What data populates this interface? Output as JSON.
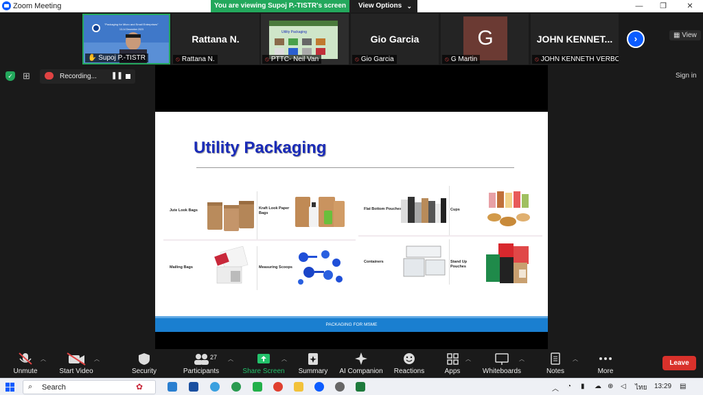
{
  "window": {
    "title": "Zoom Meeting",
    "minimize": "—",
    "restore": "❐",
    "close": "✕"
  },
  "share_banner": {
    "text": "You are viewing Supoj P.-TISTR's screen",
    "view_options": "View Options"
  },
  "participants": [
    {
      "name": "Supoj P.-TISTR",
      "big_name": "",
      "muted": false,
      "kind": "video-sharer"
    },
    {
      "name": "Rattana N.",
      "big_name": "Rattana N.",
      "muted": true,
      "kind": "name"
    },
    {
      "name": "PTTC- Neil Van",
      "big_name": "",
      "muted": true,
      "kind": "video-slide"
    },
    {
      "name": "Gio Garcia",
      "big_name": "Gio Garcia",
      "muted": true,
      "kind": "name"
    },
    {
      "name": "G Martin",
      "big_name": "",
      "avatar_letter": "G",
      "muted": true,
      "kind": "avatar"
    },
    {
      "name": "JOHN KENNETH VERBO",
      "big_name": "JOHN  KENNET...",
      "muted": true,
      "kind": "name"
    }
  ],
  "strip": {
    "next_icon": "chevron-right-icon",
    "view_label": "View"
  },
  "recording": {
    "label": "Recording..."
  },
  "sign_in": "Sign in",
  "slide": {
    "title": "Utility Packaging",
    "footer": "PACKAGING FOR MSME",
    "items": [
      {
        "label": "Jute Look Bags"
      },
      {
        "label": "Kraft Look Paper Bags"
      },
      {
        "label": "Flat Bottom Pouches"
      },
      {
        "label": "Cups"
      },
      {
        "label": "Mailing Bags"
      },
      {
        "label": "Measuring Scoops"
      },
      {
        "label": "Containers"
      },
      {
        "label": "Stand Up Pouches"
      }
    ]
  },
  "toolbar": {
    "unmute": "Unmute",
    "start_video": "Start Video",
    "security": "Security",
    "participants": "Participants",
    "participant_count": "27",
    "share_screen": "Share Screen",
    "summary": "Summary",
    "ai_companion": "AI Companion",
    "reactions": "Reactions",
    "apps": "Apps",
    "whiteboards": "Whiteboards",
    "notes": "Notes",
    "more": "More",
    "leave": "Leave"
  },
  "taskbar": {
    "search_placeholder": "Search",
    "language": "ไทย",
    "time": "13:29"
  },
  "colors": {
    "share_green": "#23a85c",
    "zoom_blue": "#0b5cff",
    "leave_red": "#d9312b",
    "slide_title": "#1a2bb8",
    "slide_footer": "#1a7fd0"
  }
}
